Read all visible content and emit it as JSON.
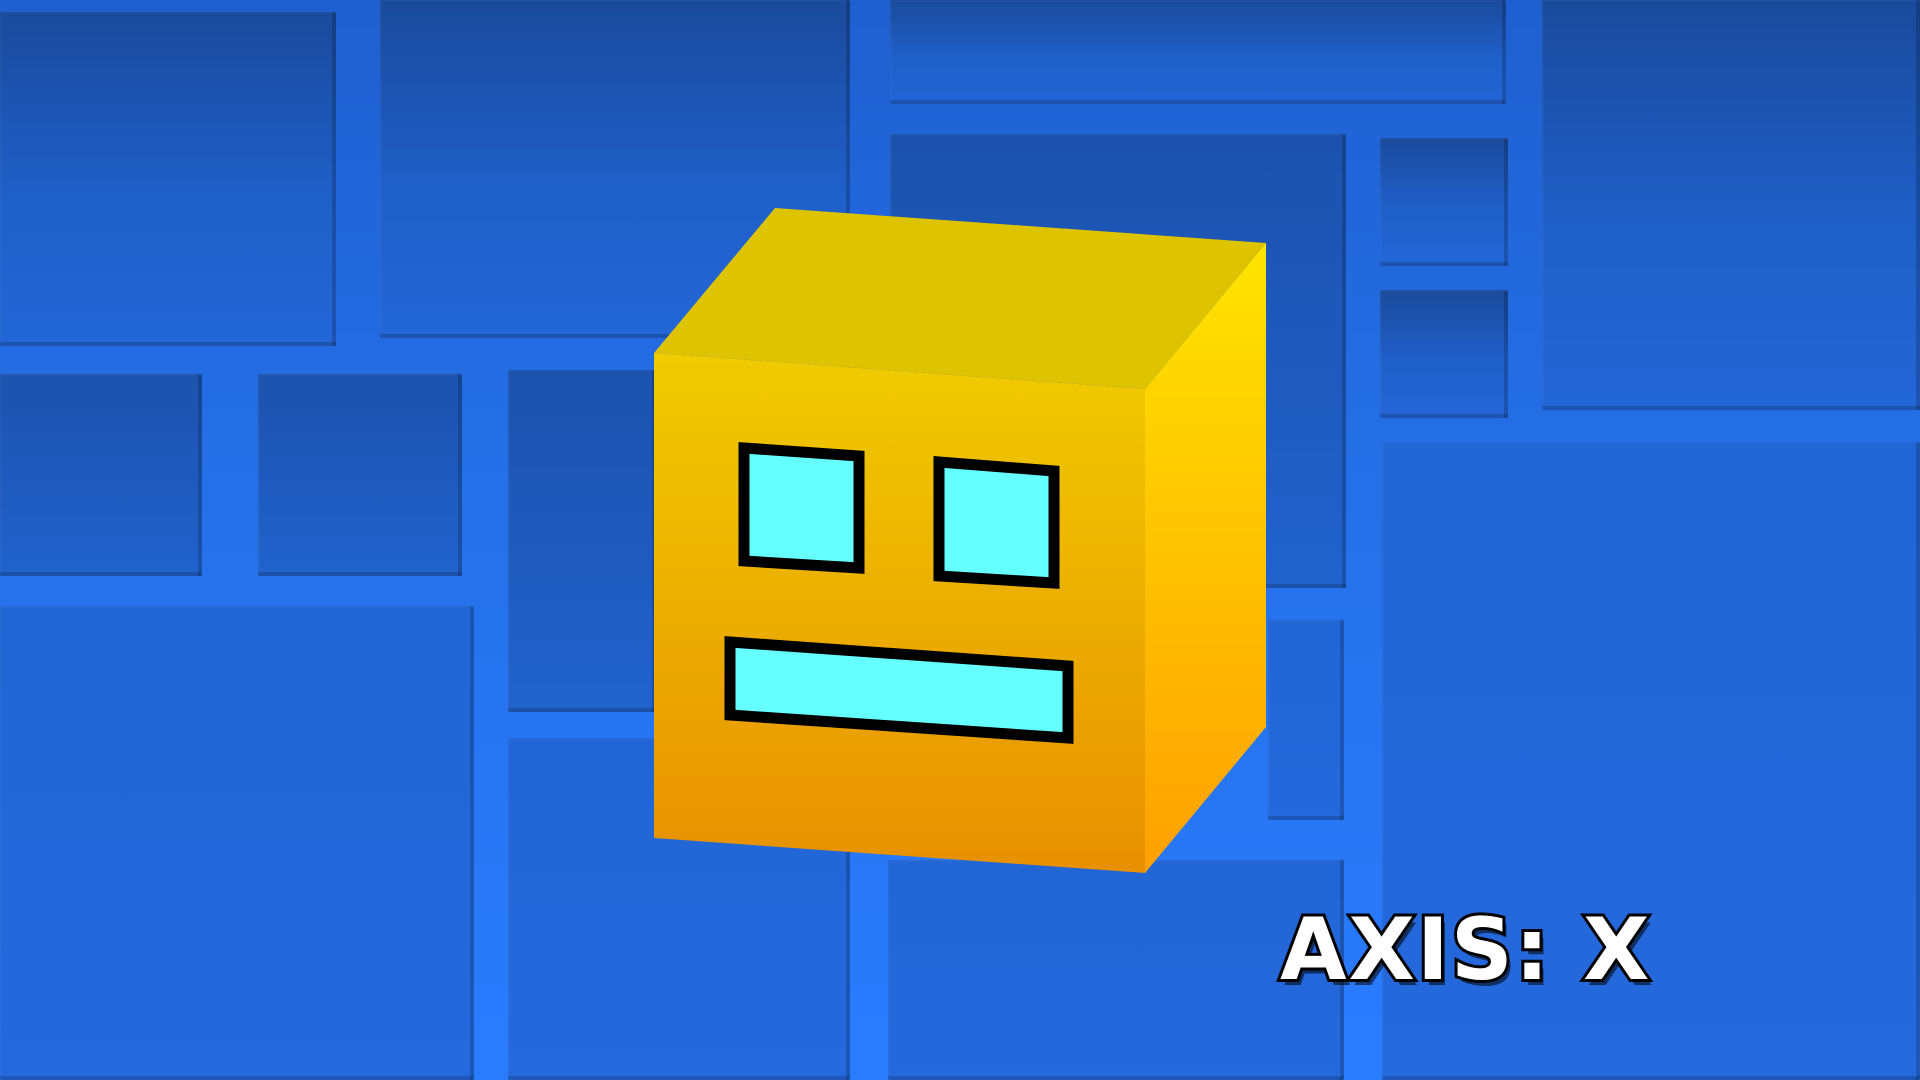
{
  "hud": {
    "axis_label": "AXIS: X"
  },
  "colors": {
    "background": "#2a7cff",
    "tile_dark": "#1a4a9a",
    "tile_light": "#2469dd",
    "cube_top": "#ddc300",
    "cube_front_top": "#f0cc00",
    "cube_front_bottom": "#e89000",
    "cube_side_top": "#ffe400",
    "cube_side_bottom": "#ffa000",
    "face_fill": "#66ffff",
    "face_outline": "#000000"
  },
  "icons": {
    "player": "cube-icon",
    "left_eye": "eye-icon",
    "right_eye": "eye-icon",
    "mouth": "mouth-icon"
  }
}
